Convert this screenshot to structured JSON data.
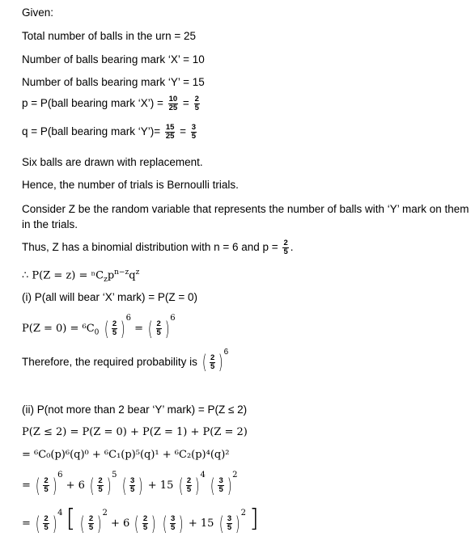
{
  "given": "Given:",
  "total": "Total number of balls in the urn = 25",
  "num_x": "Number of balls bearing mark ‘X’ = 10",
  "num_y": "Number of balls bearing mark ‘Y’ = 15",
  "p_def": {
    "lhs": "p = P(ball bearing mark ‘X’) = ",
    "f1_num": "10",
    "f1_den": "25",
    "eq": " = ",
    "f2_num": "2",
    "f2_den": "5"
  },
  "q_def": {
    "lhs": "q = P(ball bearing mark ‘Y’)= ",
    "f1_num": "15",
    "f1_den": "25",
    "eq": " = ",
    "f2_num": "3",
    "f2_den": "5"
  },
  "six_balls": "Six balls are drawn with replacement.",
  "bernoulli": "Hence, the number of trials is Bernoulli trials.",
  "consider": "Consider Z be the random variable that represents the number of balls with ‘Y’ mark on them in the trials.",
  "binomial": {
    "text": "Thus, Z has a binomial distribution with n = 6 and p = ",
    "num": "2",
    "den": "5",
    "end": "."
  },
  "pmf": "∴ P(Z = z) = ⁿC",
  "pmf_sub": "z",
  "pmf_rest": "p",
  "pmf_exp1": "n−z",
  "pmf_q": "q",
  "pmf_exp2": "z",
  "part1_title": "(i) P(all will bear ‘X’ mark) = P(Z = 0)",
  "part1_eq": {
    "lhs": "P(Z = 0) = ⁶C",
    "sub": "0",
    "num": "2",
    "den": "5",
    "exp": "6",
    "eq": " = "
  },
  "part1_result": "Therefore, the required probability is ",
  "part2_title": "(ii) P(not more than 2 bear ‘Y’ mark) = P(Z ≤ 2)",
  "part2_sum": "P(Z ≤ 2) = P(Z = 0) + P(Z = 1) + P(Z = 2)",
  "part2_expand": "= ⁶C₀(p)⁶(q)⁰ + ⁶C₁(p)⁵(q)¹ + ⁶C₂(p)⁴(q)²",
  "part2_line3": {
    "eq": "= ",
    "plus6": " + 6",
    "plus15": " + 15",
    "two": "2",
    "three": "3",
    "five": "5",
    "e6": "6",
    "e5": "5",
    "e4": "4",
    "e2": "2"
  },
  "part2_line4": {
    "eq": "= ",
    "plus6": " + 6",
    "plus15": " + 15"
  }
}
